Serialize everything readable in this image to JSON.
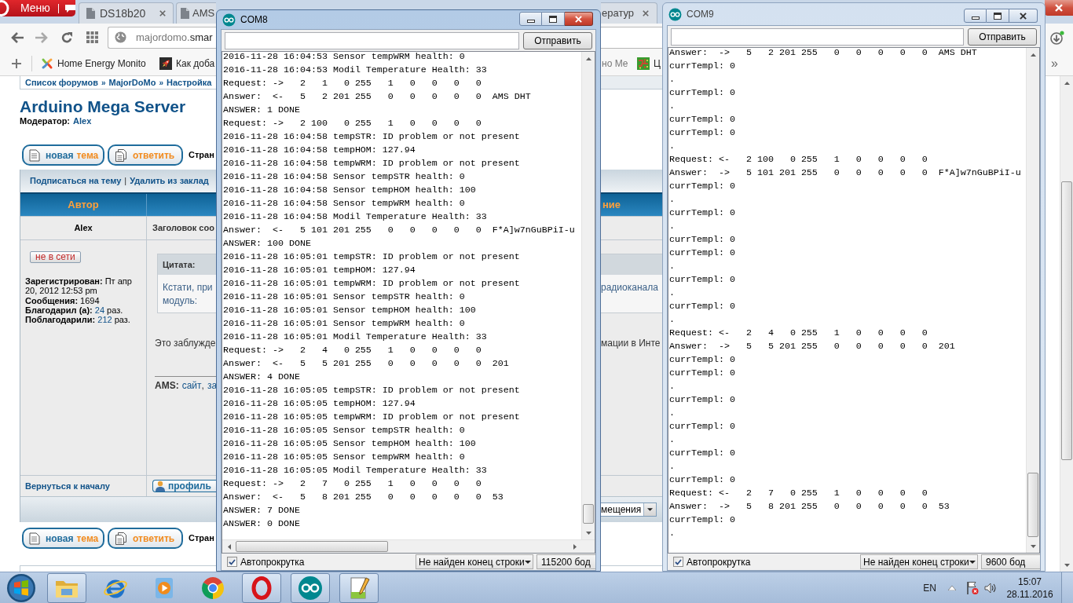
{
  "browser": {
    "menu_button": "Меню",
    "tabs": [
      {
        "title": "DS18b20",
        "selected": false
      },
      {
        "title": "AMS",
        "selected": false
      },
      {
        "title": "ератур",
        "selected": false
      }
    ],
    "address": {
      "prefix": "majordomo.",
      "host": "smar"
    },
    "bookmarks": [
      {
        "kind": "petals",
        "label": "Home Energy Monito"
      },
      {
        "kind": "rocket",
        "label": "Как доба"
      },
      {
        "kind": "none",
        "label": "но Ме"
      },
      {
        "kind": "circuit",
        "label": "Ц"
      }
    ],
    "more_bookmarks": "»",
    "page": {
      "breadcrumb": [
        "Список форумов",
        "MajorDoMo",
        "Настройка"
      ],
      "breadcrumb_separators": [
        "»",
        "»"
      ],
      "title": "Arduino Mega Server",
      "moderator_label": "Модератор:",
      "moderator": "Alex",
      "toolbars": [
        {
          "buttons": [
            {
              "kind": "new-topic",
              "text": "новая",
              "accent": "тема"
            },
            {
              "kind": "reply",
              "accent": "ответить"
            }
          ],
          "pages_label": "Стран"
        },
        {
          "buttons": [
            {
              "kind": "new-topic",
              "text": "новая",
              "accent": "тема"
            },
            {
              "kind": "reply",
              "accent": "ответить"
            }
          ],
          "pages_label": "Стран"
        }
      ],
      "topic_links": [
        "Подписаться на тему",
        "Удалить из заклад"
      ],
      "topic_links_separator": "|",
      "columns": {
        "author": "Автор",
        "message": "ние"
      },
      "post": {
        "author": "Alex",
        "subject": "Заголовок соо",
        "status": "не в сети",
        "stats": [
          {
            "label": "Зарегистрирован:",
            "value": "Пт апр 20, 2012 12:53 pm",
            "link": false
          },
          {
            "label": "Сообщения:",
            "value": "1694",
            "link": false
          },
          {
            "label": "Благодарил (а):",
            "value": "24",
            "link": true,
            "unit": "раз."
          },
          {
            "label": "Поблагодарили:",
            "value": "212",
            "link": true,
            "unit": "раз."
          }
        ],
        "quote": {
          "header": "Цитата:",
          "lines": [
            "Кстати, при",
            "модуль:"
          ],
          "right_part": "радиоканала"
        },
        "body": {
          "left_part": "Это заблужде",
          "right_part": "мации в Инте"
        },
        "signature": {
          "label": "AMS:",
          "parts": [
            {
              "text": "сайт",
              "link": true
            },
            {
              "text": ",",
              "link": false
            },
            {
              "text": "за",
              "link": true
            }
          ]
        },
        "back_to_top": "Вернуться к началу",
        "profile_button": "профиль"
      },
      "sort_select": "мещения"
    }
  },
  "serial_monitors": [
    {
      "title": "COM8",
      "active": true,
      "send_button": "Отправить",
      "lines": [
        "2016-11-28 16:04:53 Sensor tempWRM health: 0",
        "2016-11-28 16:04:53 Modil Temperature Health: 33",
        "Request: ->   2   1   0 255   1   0   0   0   0",
        "Answer:  <-   5   2 201 255   0   0   0   0   0  AMS DHT",
        "ANSWER: 1 DONE",
        "Request: ->   2 100   0 255   1   0   0   0   0",
        "2016-11-28 16:04:58 tempSTR: ID problem or not present",
        "2016-11-28 16:04:58 tempHOM: 127.94",
        "2016-11-28 16:04:58 tempWRM: ID problem or not present",
        "2016-11-28 16:04:58 Sensor tempSTR health: 0",
        "2016-11-28 16:04:58 Sensor tempHOM health: 100",
        "2016-11-28 16:04:58 Sensor tempWRM health: 0",
        "2016-11-28 16:04:58 Modil Temperature Health: 33",
        "Answer:  <-   5 101 201 255   0   0   0   0   0  F*A]w7nGuBPiI-u",
        "ANSWER: 100 DONE",
        "2016-11-28 16:05:01 tempSTR: ID problem or not present",
        "2016-11-28 16:05:01 tempHOM: 127.94",
        "2016-11-28 16:05:01 tempWRM: ID problem or not present",
        "2016-11-28 16:05:01 Sensor tempSTR health: 0",
        "2016-11-28 16:05:01 Sensor tempHOM health: 100",
        "2016-11-28 16:05:01 Sensor tempWRM health: 0",
        "2016-11-28 16:05:01 Modil Temperature Health: 33",
        "Request: ->   2   4   0 255   1   0   0   0   0",
        "Answer:  <-   5   5 201 255   0   0   0   0   0  201",
        "ANSWER: 4 DONE",
        "2016-11-28 16:05:05 tempSTR: ID problem or not present",
        "2016-11-28 16:05:05 tempHOM: 127.94",
        "2016-11-28 16:05:05 tempWRM: ID problem or not present",
        "2016-11-28 16:05:05 Sensor tempSTR health: 0",
        "2016-11-28 16:05:05 Sensor tempHOM health: 100",
        "2016-11-28 16:05:05 Sensor tempWRM health: 0",
        "2016-11-28 16:05:05 Modil Temperature Health: 33",
        "Request: ->   2   7   0 255   1   0   0   0   0",
        "Answer:  <-   5   8 201 255   0   0   0   0   0  53",
        "ANSWER: 7 DONE",
        "ANSWER: 0 DONE"
      ],
      "autoscroll": {
        "label": "Автопрокрутка",
        "checked": true
      },
      "line_ending": "Не найден конец строки",
      "baud": "115200 бод"
    },
    {
      "title": "COM9",
      "active": false,
      "send_button": "Отправить",
      "lines": [
        "Answer:  ->   5   2 201 255   0   0   0   0   0  AMS DHT",
        "currTempl: 0",
        ".",
        "currTempl: 0",
        ".",
        "currTempl: 0",
        "currTempl: 0",
        ".",
        "Request: <-   2 100   0 255   1   0   0   0   0",
        "Answer:  ->   5 101 201 255   0   0   0   0   0  F*A]w7nGuBPiI-u",
        "currTempl: 0",
        ".",
        "currTempl: 0",
        ".",
        "currTempl: 0",
        "currTempl: 0",
        ".",
        "currTempl: 0",
        ".",
        "currTempl: 0",
        ".",
        "Request: <-   2   4   0 255   1   0   0   0   0",
        "Answer:  ->   5   5 201 255   0   0   0   0   0  201",
        "currTempl: 0",
        "currTempl: 0",
        ".",
        "currTempl: 0",
        ".",
        "currTempl: 0",
        ".",
        "currTempl: 0",
        ".",
        "currTempl: 0",
        "Request: <-   2   7   0 255   1   0   0   0   0",
        "Answer:  ->   5   8 201 255   0   0   0   0   0  53",
        "currTempl: 0",
        "."
      ],
      "autoscroll": {
        "label": "Автопрокрутка",
        "checked": true
      },
      "line_ending": "Не найден конец строки",
      "baud": "9600 бод"
    }
  ],
  "taskbar": {
    "apps": [
      {
        "kind": "folder",
        "running": true
      },
      {
        "kind": "ring-orbit",
        "running": false
      },
      {
        "kind": "play",
        "running": false
      },
      {
        "kind": "ball",
        "running": false
      },
      {
        "kind": "o-ring",
        "running": true
      },
      {
        "kind": "infinity",
        "running": true
      },
      {
        "kind": "notepad",
        "running": true
      }
    ],
    "language": "EN",
    "time": "15:07",
    "date": "28.11.2016"
  }
}
